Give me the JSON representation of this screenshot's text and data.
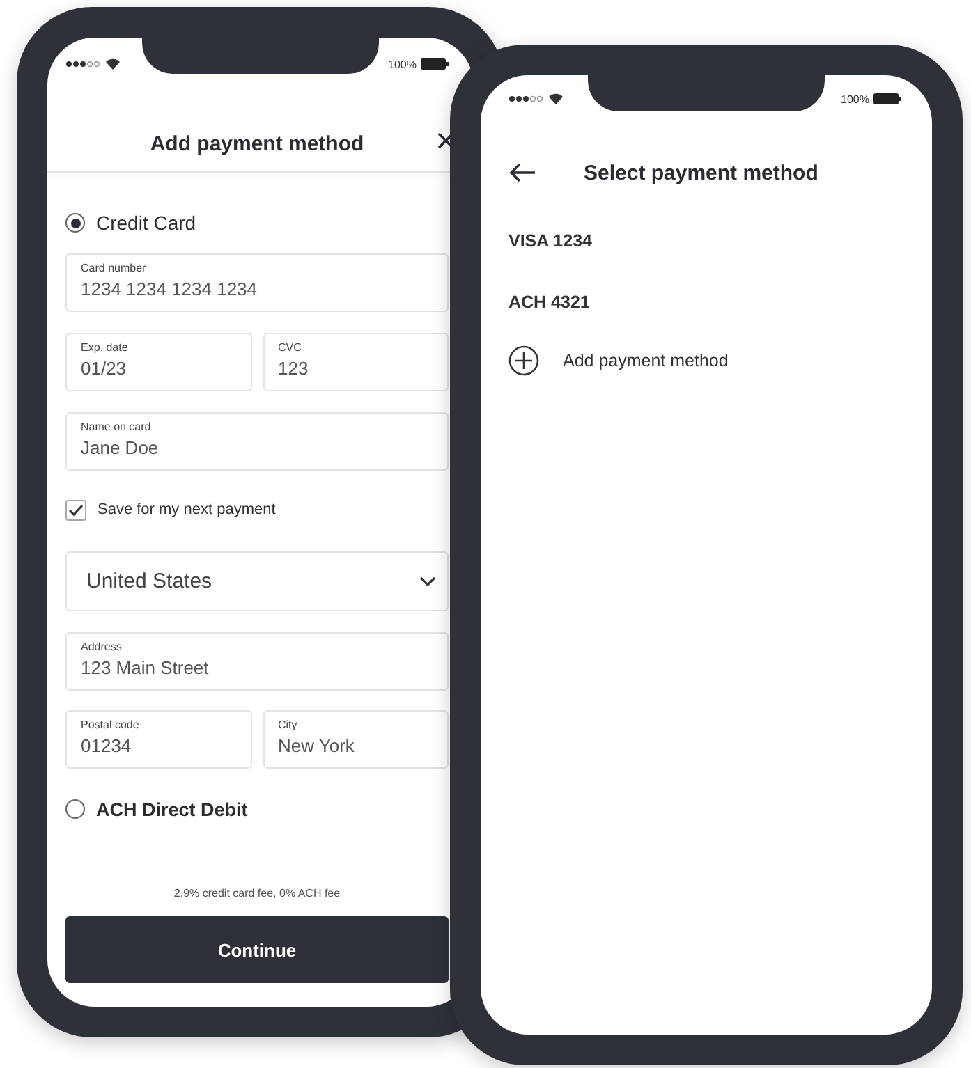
{
  "add_payment_screen": {
    "status_bar": {
      "battery": "100%"
    },
    "title": "Add payment method",
    "form": [
      {
        "kind": "radio",
        "label": "Credit Card",
        "selected": true
      },
      {
        "kind": "fields",
        "fields": [
          {
            "label": "Card number",
            "value": "1234 1234 1234 1234"
          }
        ]
      },
      {
        "kind": "fields",
        "fields": [
          {
            "label": "Exp. date",
            "value": "01/23"
          },
          {
            "label": "CVC",
            "value": "123"
          }
        ]
      },
      {
        "kind": "fields",
        "fields": [
          {
            "label": "Name on card",
            "value": "Jane Doe"
          }
        ]
      },
      {
        "kind": "checkbox",
        "label": "Save for my next payment",
        "checked": true
      },
      {
        "kind": "select",
        "value": "United States"
      },
      {
        "kind": "fields",
        "fields": [
          {
            "label": "Address",
            "value": "123 Main Street"
          }
        ]
      },
      {
        "kind": "fields",
        "fields": [
          {
            "label": "Postal code",
            "value": "01234"
          },
          {
            "label": "City",
            "value": "New York"
          }
        ]
      },
      {
        "kind": "radio",
        "label": "ACH Direct Debit",
        "selected": false
      }
    ],
    "fee_note": "2.9% credit card fee, 0% ACH fee",
    "continue_button": "Continue"
  },
  "select_payment_screen": {
    "status_bar": {
      "battery": "100%"
    },
    "title": "Select payment method",
    "methods": [
      "VISA 1234",
      "ACH 4321"
    ],
    "add_label": "Add payment method"
  }
}
